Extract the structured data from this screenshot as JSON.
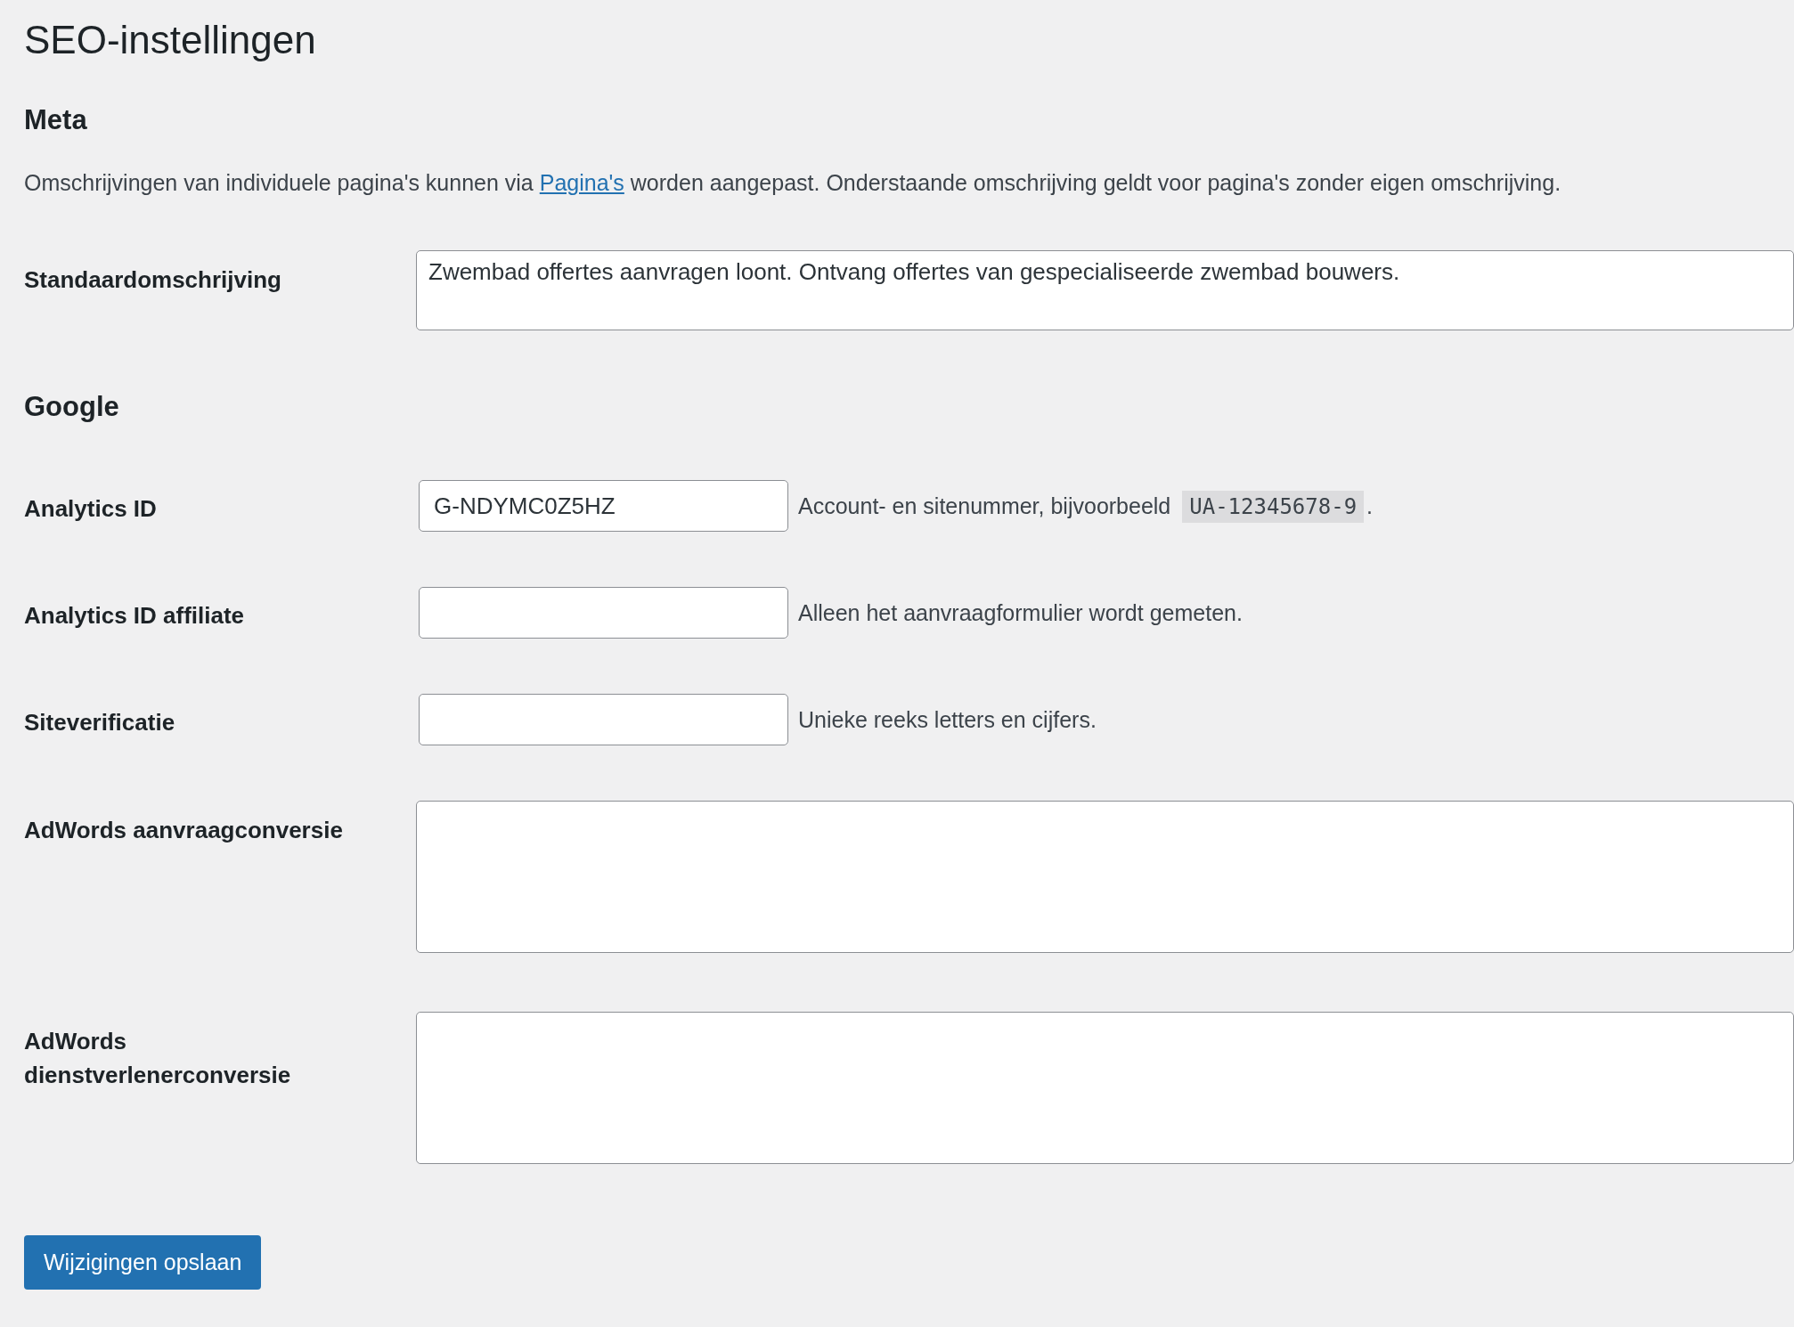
{
  "page": {
    "title": "SEO-instellingen"
  },
  "sections": [
    {
      "heading": "Meta",
      "description": {
        "before": "Omschrijvingen van individuele pagina's kunnen via ",
        "link": "Pagina's",
        "after": " worden aangepast. Onderstaande omschrijving geldt voor pagina's zonder eigen omschrijving."
      },
      "fields": [
        {
          "kind": "textarea",
          "label": "Standaardomschrijving",
          "value": "Zwembad offertes aanvragen loont. Ontvang offertes van gespecialiseerde zwembad bouwers."
        }
      ]
    },
    {
      "heading": "Google",
      "fields": [
        {
          "kind": "input",
          "label": "Analytics ID",
          "value": "G-NDYMC0Z5HZ",
          "hint": {
            "before": "Account- en sitenummer, bijvoorbeeld ",
            "code": "UA-12345678-9",
            "after": "."
          }
        },
        {
          "kind": "input",
          "label": "Analytics ID affiliate",
          "hint": {
            "before": "Alleen het aanvraagformulier wordt gemeten."
          }
        },
        {
          "kind": "input",
          "label": "Siteverificatie",
          "hint": {
            "before": "Unieke reeks letters en cijfers."
          }
        },
        {
          "kind": "tall-textarea",
          "label": "AdWords aanvraagconversie"
        },
        {
          "kind": "tall-textarea",
          "label": "AdWords dienstverlenerconversie"
        }
      ]
    }
  ],
  "submit": {
    "label": "Wijzigingen opslaan"
  }
}
